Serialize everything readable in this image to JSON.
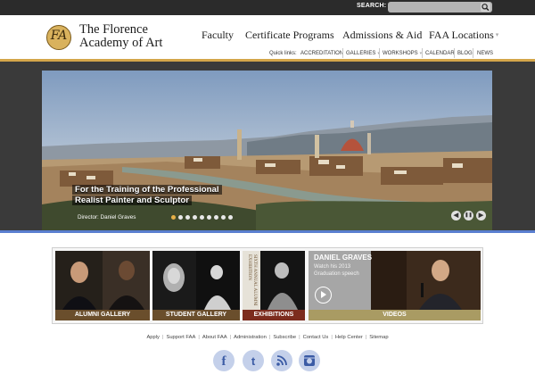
{
  "search": {
    "label": "SEARCH:",
    "value": "",
    "icon": "search-icon"
  },
  "brand": {
    "line1": "The Florence",
    "line2": "Academy of Art",
    "monogram": "FA",
    "logo_color": "#d9b25d"
  },
  "nav": {
    "items": [
      {
        "label": "Faculty"
      },
      {
        "label": "Certificate Programs"
      },
      {
        "label": "Admissions & Aid"
      },
      {
        "label": "FAA Locations"
      }
    ],
    "chevron": "▾"
  },
  "quicklinks": {
    "label": "Quick links:",
    "items": [
      "ACCREDITATION",
      "GALLERIES",
      "WORKSHOPS",
      "CALENDAR",
      "BLOG",
      "NEWS"
    ],
    "caret": "▾"
  },
  "hero": {
    "caption_line1": "For the Training of the Professional",
    "caption_line2": "Realist Painter and Sculptor",
    "director": "Director: Daniel Graves",
    "slide_count": 9,
    "active_slide": 1,
    "controls": {
      "prev": "◀",
      "pause": "❚❚",
      "next": "▶"
    }
  },
  "tiles": [
    {
      "label": "ALUMNI GALLERY",
      "color": "#6a4e2c"
    },
    {
      "label": "STUDENT GALLERY",
      "color": "#6a4e2c"
    },
    {
      "label": "EXHIBITIONS",
      "color": "#7c2c1e"
    },
    {
      "label": "VIDEOS",
      "color": "#a99b63"
    }
  ],
  "video_tile": {
    "title": "DANIEL GRAVES",
    "sub1": "Watch his 2013",
    "sub2": "Graduation speech"
  },
  "exhibition_tile": {
    "vertical_text": "SIXTH ANNUAL ALUMNI EXHIBITION"
  },
  "footer": {
    "links": [
      "Apply",
      "Support FAA",
      "About FAA",
      "Administration",
      "Subscribe",
      "Contact Us",
      "Help Center",
      "Sitemap"
    ],
    "separator": "|"
  },
  "social": [
    {
      "name": "facebook-icon",
      "glyph": "f"
    },
    {
      "name": "twitter-icon",
      "glyph": "t"
    },
    {
      "name": "rss-icon",
      "glyph": ""
    },
    {
      "name": "instagram-icon",
      "glyph": ""
    }
  ],
  "colors": {
    "gold": "#d4a64a",
    "hero_blue": "#5a7fd0",
    "topbar": "#2b2b2b",
    "social": "#c4d0ea"
  }
}
